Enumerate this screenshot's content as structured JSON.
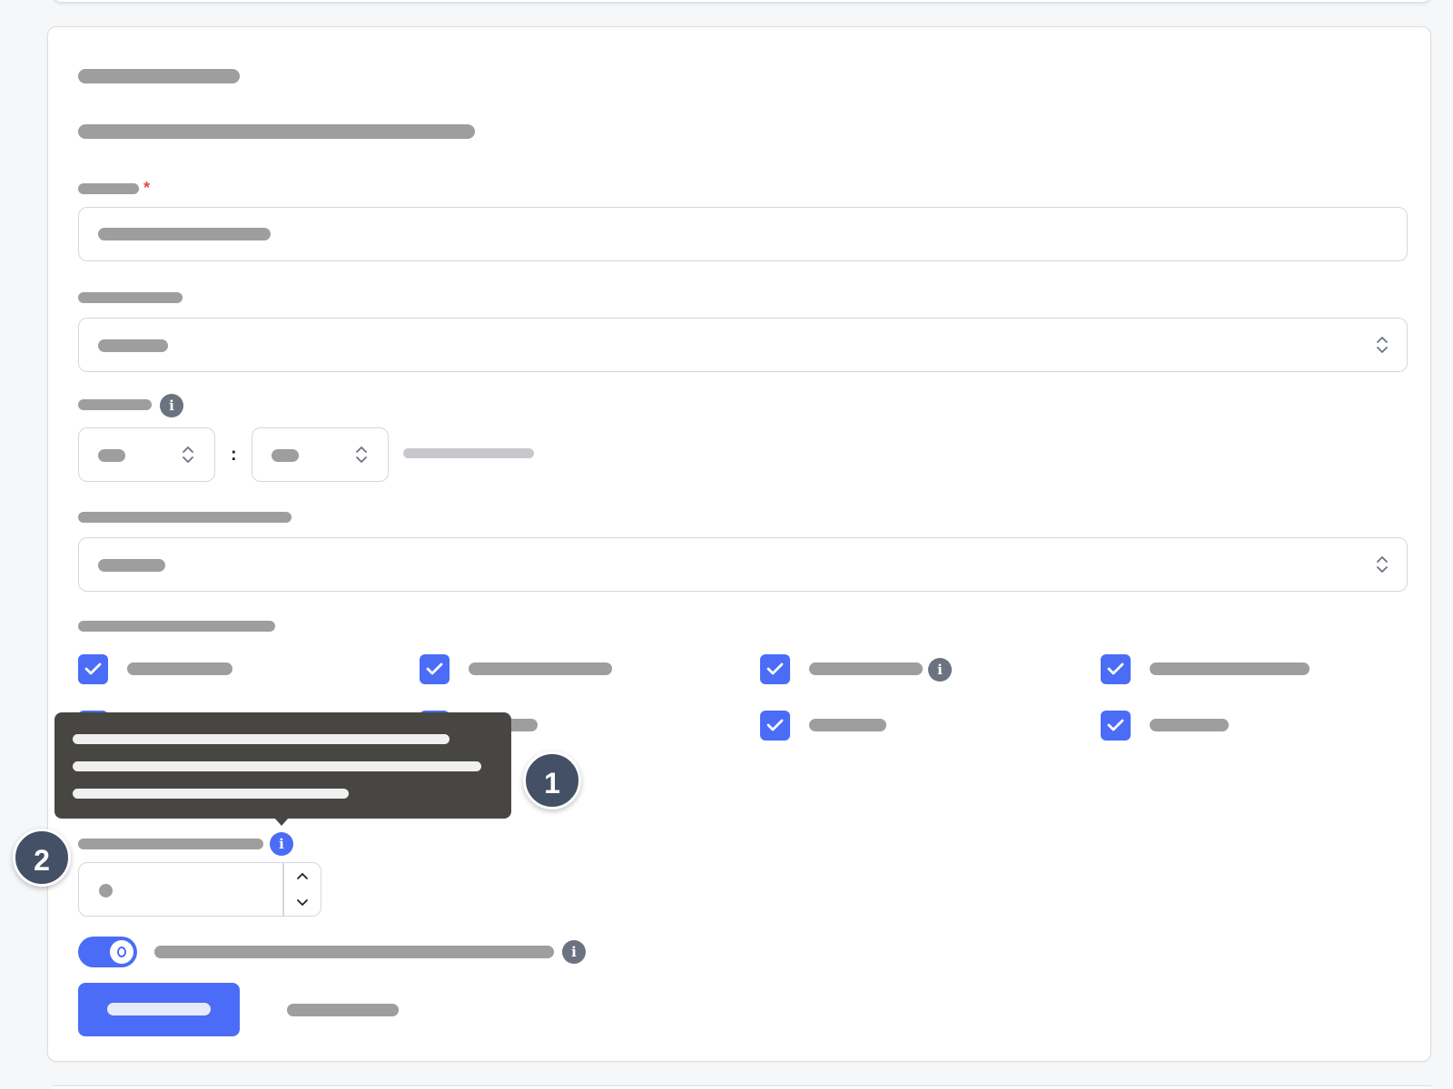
{
  "form": {
    "required_mark": "*",
    "time_separator": ":",
    "info_glyph": "i",
    "checkbox_columns": 4,
    "checkboxes_checked": [
      true,
      true,
      true,
      true,
      true,
      true,
      true,
      true
    ]
  },
  "toggle": {
    "state": "on"
  },
  "markers": [
    {
      "label": "1"
    },
    {
      "label": "2"
    }
  ],
  "colors": {
    "accent": "#4a6cf7",
    "required": "#ef4444",
    "tooltip_bg": "#474643",
    "marker_bg": "#435066",
    "placeholder_bar": "#9e9e9e"
  },
  "icons": [
    "info-icon",
    "chevron-updown-icon",
    "checkmark-icon",
    "chevron-up-icon",
    "chevron-down-icon"
  ]
}
